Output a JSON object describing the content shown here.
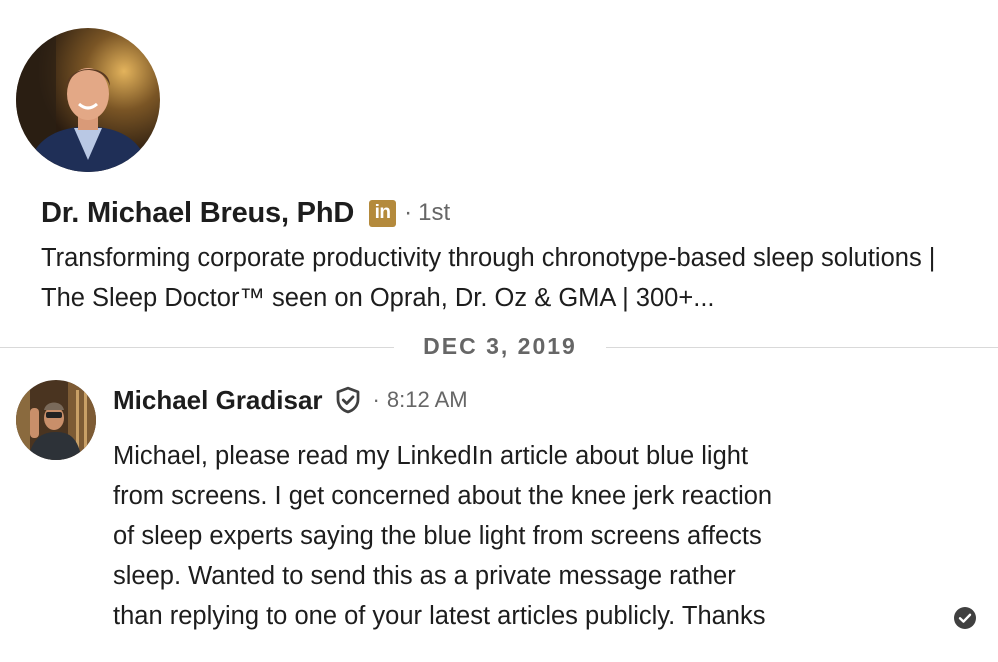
{
  "profile": {
    "avatar_icon": "profile-photo",
    "name": "Dr. Michael Breus, PhD",
    "badge": "in",
    "badge_color": "#b48a3c",
    "separator": "·",
    "degree": "1st",
    "headline": "Transforming corporate productivity through chronotype-based sleep solutions | The Sleep Doctor™ seen on Oprah, Dr. Oz & GMA | 300+..."
  },
  "conversation": {
    "date_label": "DEC 3, 2019",
    "message": {
      "sender_avatar_icon": "sender-photo",
      "sender": "Michael Gradisar",
      "verified_icon": "shield-check-icon",
      "separator": "·",
      "time": "8:12 AM",
      "lines": [
        "Michael, please read my LinkedIn article about blue light",
        "from screens. I get concerned about the knee jerk reaction",
        "of sleep experts saying the blue light from screens affects",
        "sleep. Wanted to send this as a private message rather",
        "than replying to one of your latest articles publicly. Thanks"
      ],
      "read_icon": "check-circle-icon"
    }
  }
}
